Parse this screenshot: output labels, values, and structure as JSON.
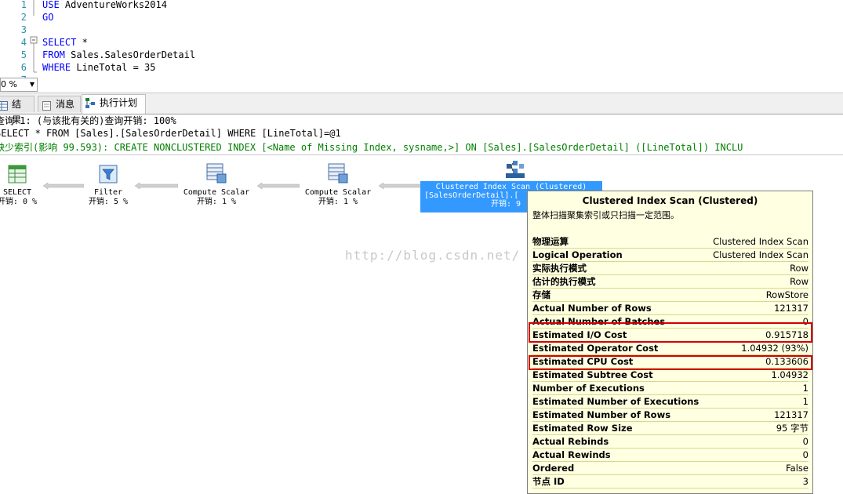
{
  "editor": {
    "lines": [
      {
        "num": "1",
        "kw": "USE",
        "rest": " AdventureWorks2014"
      },
      {
        "num": "2",
        "kw": "GO",
        "rest": ""
      },
      {
        "num": "3",
        "kw": "",
        "rest": ""
      },
      {
        "num": "4",
        "kw": "SELECT",
        "rest": " *"
      },
      {
        "num": "5",
        "kw": "FROM",
        "rest": " Sales.SalesOrderDetail"
      },
      {
        "num": "6",
        "kw": "WHERE",
        "rest": " LineTotal = 35"
      },
      {
        "num": "7",
        "kw": "",
        "rest": ""
      }
    ],
    "zoom": "0 %"
  },
  "tabs": [
    {
      "label": "结果",
      "icon": "grid-icon"
    },
    {
      "label": "消息",
      "icon": "message-icon"
    },
    {
      "label": "执行计划",
      "icon": "execution-plan-icon"
    }
  ],
  "query": {
    "line1": "查询 1: (与该批有关的)查询开销: 100%",
    "line2": "SELECT * FROM [Sales].[SalesOrderDetail] WHERE [LineTotal]=@1",
    "line3": "缺少索引(影响 99.593): CREATE NONCLUSTERED INDEX [<Name of Missing Index, sysname,>] ON [Sales].[SalesOrderDetail] ([LineTotal]) INCLU"
  },
  "plan": {
    "nodes": [
      {
        "name": "SELECT",
        "cost": "开销: 0 %"
      },
      {
        "name": "Filter",
        "cost": "开销: 5 %"
      },
      {
        "name": "Compute Scalar",
        "cost": "开销: 1 %"
      },
      {
        "name": "Compute Scalar",
        "cost": "开销: 1 %"
      }
    ],
    "selected": {
      "line1": "Clustered Index Scan (Clustered)",
      "line2": "[SalesOrderDetail].[",
      "cost": "开销: 9"
    },
    "watermark": "http://blog.csdn.net/"
  },
  "tooltip": {
    "title": "Clustered Index Scan (Clustered)",
    "description": "整体扫描聚集索引或只扫描一定范围。",
    "rows": [
      {
        "k": "物理运算",
        "v": "Clustered Index Scan"
      },
      {
        "k": "Logical Operation",
        "v": "Clustered Index Scan"
      },
      {
        "k": "实际执行模式",
        "v": "Row"
      },
      {
        "k": "估计的执行模式",
        "v": "Row"
      },
      {
        "k": "存储",
        "v": "RowStore"
      },
      {
        "k": "Actual Number of Rows",
        "v": "121317"
      },
      {
        "k": "Actual Number of Batches",
        "v": "0"
      },
      {
        "k": "Estimated I/O Cost",
        "v": "0.915718"
      },
      {
        "k": "Estimated Operator Cost",
        "v": "1.04932 (93%)"
      },
      {
        "k": "Estimated CPU Cost",
        "v": "0.133606"
      },
      {
        "k": "Estimated Subtree Cost",
        "v": "1.04932"
      },
      {
        "k": "Number of Executions",
        "v": "1"
      },
      {
        "k": "Estimated Number of Executions",
        "v": "1"
      },
      {
        "k": "Estimated Number of Rows",
        "v": "121317"
      },
      {
        "k": "Estimated Row Size",
        "v": "95 字节"
      },
      {
        "k": "Actual Rebinds",
        "v": "0"
      },
      {
        "k": "Actual Rewinds",
        "v": "0"
      },
      {
        "k": "Ordered",
        "v": "False"
      },
      {
        "k": "节点 ID",
        "v": "3"
      }
    ],
    "highlight_color": "#d40000"
  }
}
